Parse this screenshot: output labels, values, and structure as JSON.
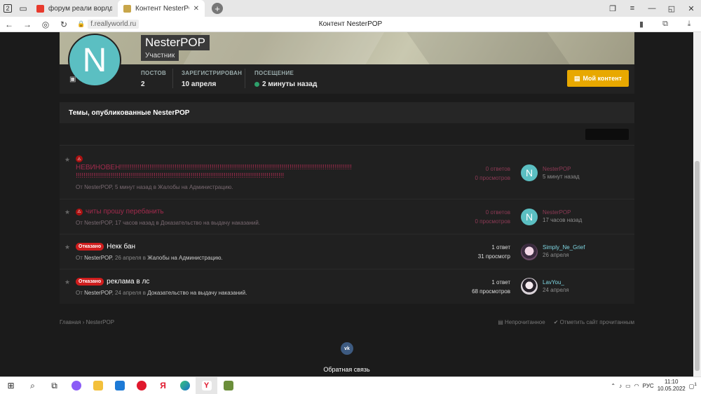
{
  "browser": {
    "tabs": [
      {
        "title": "форум реали ворлд — Як",
        "favicon_color": "#e83a2d"
      },
      {
        "title": "Контент NesterPOP",
        "favicon_color": "#c8a64a"
      }
    ],
    "tab_count": "2",
    "url": "f.reallyworld.ru",
    "page_title": "Контент NesterPOP"
  },
  "profile": {
    "avatar_letter": "N",
    "name": "NesterPOP",
    "role": "Участник",
    "stats": [
      {
        "label": "ПОСТОВ",
        "value": "2"
      },
      {
        "label": "ЗАРЕГИСТРИРОВАН",
        "value": "10 апреля"
      },
      {
        "label": "ПОСЕЩЕНИЕ",
        "value": "2 минуты назад"
      }
    ],
    "my_content_label": "Мой контент",
    "accent_color": "#e8a800"
  },
  "topics": {
    "heading": "Темы, опубликованные NesterPOP",
    "rows": [
      {
        "title": "НЕВИНОВЕН!!!!!!!!!!!!!!!!!!!!!!!!!!!!!!!!!!!!!!!!!!!!!!!!!!!!!!!!!!!!!!!!!!!!!!!!!!!!!!!!!!!!!!!!!!!!!!!!!!!!!!!!!!!!!!!!!!!!!!!",
        "title_cont": "!!!!!!!!!!!!!!!!!!!!!!!!!!!!!!!!!!!!!!!!!!!!!!!!!!!!!!!!!!!!!!!!!!!!!!!!!!!!!!!!!!!!!!!!!!!!!!!!!!!!!!!!!!!",
        "meta_by": "От NesterPOP, 5 минут назад в Жалобы на Администрацию.",
        "replies": "0 ответов",
        "views": "0 просмотров",
        "last_user": "NesterPOP",
        "last_time": "5 минут назад"
      },
      {
        "title": "читы прошу перебанить",
        "meta_by": "От NesterPOP, 17 часов назад в Доказательство на выдачу наказаний.",
        "replies": "0 ответов",
        "views": "0 просмотров",
        "last_user": "NesterPOP",
        "last_time": "17 часов назад"
      },
      {
        "badge": "Отказано",
        "title": "Некк бан",
        "meta_prefix": "От",
        "meta_user": "NesterPOP",
        "meta_time": ", 26 апреля в",
        "meta_forum": "Жалобы на Администрацию.",
        "replies": "1 ответ",
        "views": "31 просмотр",
        "last_user": "Simply_Ne_Grief",
        "last_time": "26 апреля"
      },
      {
        "badge": "Отказано",
        "title": "реклама в лс",
        "meta_prefix": "От",
        "meta_user": "NesterPOP",
        "meta_time": ", 24 апреля в",
        "meta_forum": "Доказательство на выдачу наказаний.",
        "replies": "1 ответ",
        "views": "68 просмотров",
        "last_user": "LavYou_",
        "last_time": "24 апреля"
      }
    ]
  },
  "footer": {
    "breadcrumb_home": "Главная",
    "breadcrumb_sep": "›",
    "breadcrumb_current": "NesterPOP",
    "unread": "Непрочитанное",
    "mark_read": "Отметить сайт прочитанным",
    "vk": "vk",
    "feedback": "Обратная связь"
  },
  "taskbar": {
    "lang": "РУС",
    "time": "11:10",
    "date": "10.05.2022",
    "notifications": "1"
  }
}
